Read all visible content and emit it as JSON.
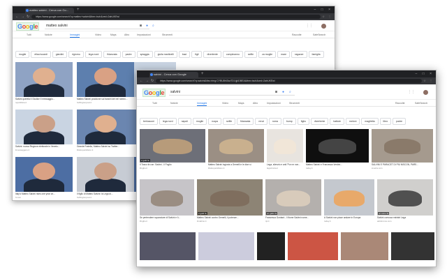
{
  "win1": {
    "tab_title": "matteo salvini - Cerca con Go...",
    "url": "https://www.google.com/search?q=matteo+salvini&tbm=isch&ved=2ahUKEwi",
    "query": "matteo salvini",
    "tabs": [
      "Tutti",
      "Notizie",
      "Immagini",
      "Video",
      "Maps",
      "Altro",
      "Impostazioni",
      "Strumenti"
    ],
    "right": [
      "Raccolte",
      "SafeSearch"
    ],
    "chips": [
      "moglie",
      "elisa isoardi",
      "giardini",
      "rigiorno",
      "lega nord",
      "fidanzata",
      "padre",
      "spiaggia",
      "giulia martinelli",
      "baci",
      "figli",
      "divertente",
      "compleanno",
      "selfie",
      "za moglie",
      "mare",
      "ragazze",
      "famiglia"
    ],
    "images": [
      {
        "cap": "Salvini querela il Giudice Il messaggio...",
        "src": "repubblica.it",
        "dim": ""
      },
      {
        "cap": "Matteo Salvini posizione sui banchi dei nel romeo...",
        "src": "huffingtonpost.it",
        "dim": ""
      },
      {
        "cap": "Salvini: nuova Regione elettorale in Veneto...",
        "src": "ilmessaggero.it",
        "dim": ""
      },
      {
        "cap": "Grande Fratello, Matteo Salvini su Twitter...",
        "src": "ilfattoquotidiano.it",
        "dim": ""
      },
      {
        "cap": "Italy's Matteo Salvini rises one year on...",
        "src": "ft.com",
        "dim": ""
      },
      {
        "cap": "Il figlio di Matteo Salvini: la Lega di...",
        "src": "huffingtonpost.it",
        "dim": ""
      }
    ]
  },
  "win2": {
    "tab_title": "salvini - Cerca con Google",
    "url": "https://www.google.com/search?q=salvini&tbs=rimg:CYBU8hGkaTD1Ijj4DBEA&tbm=isch&ved=2ahUKEwi",
    "query": "salvini",
    "tabs": [
      "Tutti",
      "Notizie",
      "Immagini",
      "Video",
      "Maps",
      "Altro",
      "Impostazioni",
      "Strumenti"
    ],
    "right": [
      "Raccolte",
      "SafeSearch"
    ],
    "chips": [
      "berlusconi",
      "lega nord",
      "napoli",
      "moglie",
      "ruspa",
      "selfie",
      "fidanzata",
      "renzi",
      "roma",
      "bump",
      "figlio",
      "divertente",
      "battute",
      "meloni",
      "maglietta",
      "libro",
      "padre"
    ],
    "row1": [
      {
        "cap": "Il Tosco fa con: Salvini - Il Foglio",
        "src": "ilfoglio.it",
        "dim": "2 gatti fa"
      },
      {
        "cap": "Matteo Salvini ingiuria a Gemelli e le dice sì",
        "src": "ilfattoquotidiano.it",
        "dim": ""
      },
      {
        "cap": "Lega, silenzio e anti 'Pur ne non...",
        "src": "lagazzetta.it",
        "dim": ""
      },
      {
        "cap": "Matteo Salvini e Francesca Verdini...",
        "src": "today.it",
        "dim": ""
      },
      {
        "cap": "SALVINI E PARACET DI PIÙ NISCON, PARE...",
        "src": "ioverta.com",
        "dim": ""
      }
    ],
    "row2": [
      {
        "cap": "Se pertendere supanziare di Salvini e lì...",
        "src": "ilfoglio.it",
        "dim": ""
      },
      {
        "cap": "Matteo Salvini contro Gemelli, il potenze...",
        "src": "ilmattino.it",
        "dim": "2 gatti fa"
      },
      {
        "cap": "Francesca Gontard - Il fiume Salvini nome...",
        "src": "tpi.it",
        "dim": "un gatto fa"
      },
      {
        "cap": "A Salvini non piace andare in Europa",
        "src": "today.it",
        "dim": ""
      },
      {
        "cap": "Salvini convoca ministri Lega",
        "src": "adnkronos.com",
        "dim": "un anno fa"
      }
    ]
  },
  "colors": {
    "google_blue": "#4285f4",
    "google_red": "#ea4335",
    "google_yellow": "#fbbc05",
    "google_green": "#34a853",
    "chrome_dark": "#202124",
    "active_tab": "#1a73e8"
  },
  "icons": [
    "google-favicon",
    "mic-icon",
    "search-icon",
    "camera-icon",
    "apps-icon",
    "close-icon",
    "star-icon"
  ]
}
